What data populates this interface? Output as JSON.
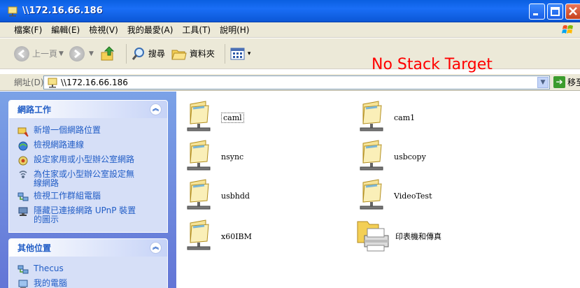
{
  "window": {
    "title": "\\\\172.16.66.186"
  },
  "menu": [
    "檔案(F)",
    "編輯(E)",
    "檢視(V)",
    "我的最愛(A)",
    "工具(T)",
    "說明(H)"
  ],
  "toolbar": {
    "back_label": "上一頁",
    "search_label": "搜尋",
    "folders_label": "資料夾"
  },
  "overlay_text": "No Stack Target",
  "address": {
    "label": "網址(D)",
    "value": "\\\\172.16.66.186",
    "go_label": "移至"
  },
  "network_tasks": {
    "title": "網路工作",
    "items": [
      {
        "label": "新增一個網路位置",
        "icon": "add-network-place-icon"
      },
      {
        "label": "檢視網路連線",
        "icon": "network-connections-icon"
      },
      {
        "label": "設定家用或小型辦公室網路",
        "icon": "setup-network-icon"
      },
      {
        "label": "為住家或小型辦公室設定無\n線網路",
        "icon": "wireless-network-icon"
      },
      {
        "label": "檢視工作群組電腦",
        "icon": "workgroup-computers-icon"
      },
      {
        "label": "隱藏已連接網路 UPnP 裝置\n的圖示",
        "icon": "upnp-device-icon"
      }
    ]
  },
  "other_places": {
    "title": "其他位置",
    "items": [
      {
        "label": "Thecus",
        "icon": "workgroup-icon"
      },
      {
        "label": "我的電腦",
        "icon": "my-computer-icon"
      }
    ]
  },
  "shares": [
    {
      "name": "caml",
      "type": "share",
      "selected": true
    },
    {
      "name": "cam1",
      "type": "share",
      "selected": false
    },
    {
      "name": "nsync",
      "type": "share",
      "selected": false
    },
    {
      "name": "usbcopy",
      "type": "share",
      "selected": false
    },
    {
      "name": "usbhdd",
      "type": "share",
      "selected": false
    },
    {
      "name": "VideoTest",
      "type": "share",
      "selected": false
    },
    {
      "name": "x60IBM",
      "type": "share",
      "selected": false
    },
    {
      "name": "印表機和傳真",
      "type": "printers",
      "selected": false
    }
  ]
}
